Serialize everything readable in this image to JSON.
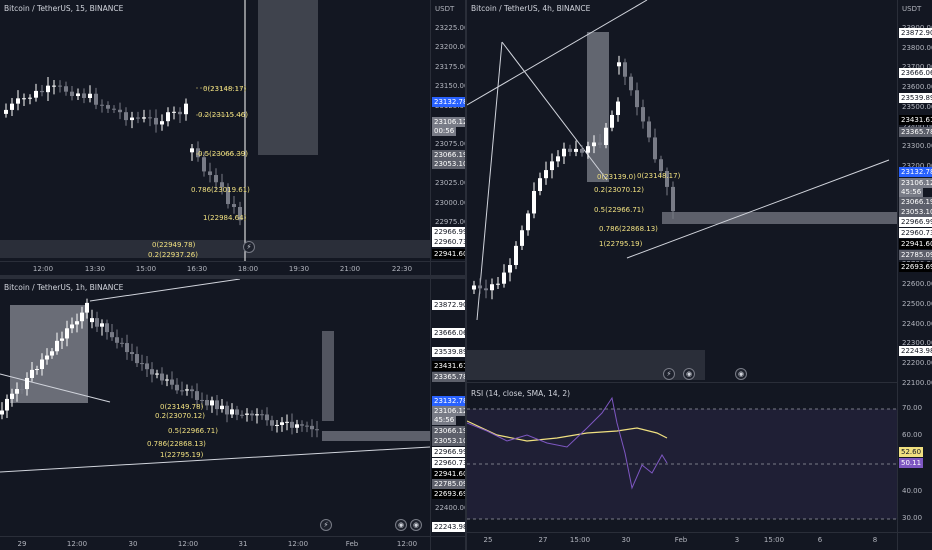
{
  "colors": {
    "bg": "#131722",
    "up": "#ffffff",
    "down": "#787b86",
    "grid": "#2a2e39",
    "fib": "#f0e080",
    "rsi": "#7e57c2",
    "rsi_ma": "#f0e080"
  },
  "panel_tl": {
    "title": "Bitcoin / TetherUS, 15, BINANCE",
    "unit": "USDT",
    "ticks": [
      "23225.00",
      "23200.00",
      "23175.00",
      "23150.00",
      "23125.00",
      "23100.00",
      "23075.00",
      "23050.00",
      "23025.00",
      "23000.00",
      "22975.00",
      "22950.00"
    ],
    "price_labels": [
      "23132.78",
      "23106.12",
      "00:56",
      "23066.19",
      "23053.10",
      "22966.99",
      "22960.73",
      "22941.60"
    ],
    "time_ticks": [
      "12:00",
      "13:30",
      "15:00",
      "16:30",
      "18:00",
      "19:30",
      "21:00",
      "22:30"
    ],
    "fib": [
      "0(23148.17)",
      "0.2(23115.46)",
      "0.5(23066.39)",
      "0.786(23019.61)",
      "1(22984.64)",
      "0(22949.78)",
      "0.2(22937.26)"
    ]
  },
  "panel_bl": {
    "title": "Bitcoin / TetherUS, 1h, BINANCE",
    "unit": "",
    "ticks": [
      "23872.90",
      "23666.06",
      "23539.89",
      "23431.61",
      "23365.78",
      "23132.78",
      "23106.12",
      "45:56",
      "23066.19",
      "23053.10",
      "22966.99",
      "22960.73",
      "22941.60",
      "22785.09",
      "22693.69",
      "22400.00",
      "22243.98"
    ],
    "time_ticks": [
      "29",
      "12:00",
      "30",
      "12:00",
      "31",
      "12:00",
      "Feb",
      "12:00"
    ],
    "fib": [
      "0(23149.78)",
      "0.2(23070.12)",
      "0.5(22966.71)",
      "0.786(22868.13)",
      "1(22795.19)"
    ]
  },
  "panel_r": {
    "title": "Bitcoin / TetherUS, 4h, BINANCE",
    "unit": "USDT",
    "ticks": [
      "23900.00",
      "23800.00",
      "23700.00",
      "23600.00",
      "23500.00",
      "23400.00",
      "23300.00",
      "23200.00",
      "23100.00",
      "23000.00",
      "22900.00",
      "22800.00",
      "22700.00",
      "22600.00",
      "22500.00",
      "22400.00",
      "22300.00",
      "22200.00",
      "22100.00"
    ],
    "price_labels": [
      "23872.90",
      "23666.06",
      "23539.89",
      "23431.61",
      "23365.78",
      "23132.78",
      "23106.12",
      "45:56",
      "23066.19",
      "23053.10",
      "22966.99",
      "22960.73",
      "22941.60",
      "22785.09",
      "22693.69",
      "22243.98"
    ],
    "time_ticks": [
      "25",
      "27",
      "15:00",
      "30",
      "Feb",
      "3",
      "15:00",
      "6",
      "8"
    ],
    "fib": [
      "0(23139.0)",
      "0.2(23070.12)",
      "0.5(22966.71)",
      "0.786(22868.13)",
      "1(22795.19)",
      "0(23148.17)"
    ],
    "rsi_title": "RSI (14, close, SMA, 14, 2)",
    "rsi_ticks": [
      "70.00",
      "60.00",
      "40.00",
      "30.00"
    ],
    "rsi_labels": [
      "52.60",
      "50.11"
    ]
  }
}
